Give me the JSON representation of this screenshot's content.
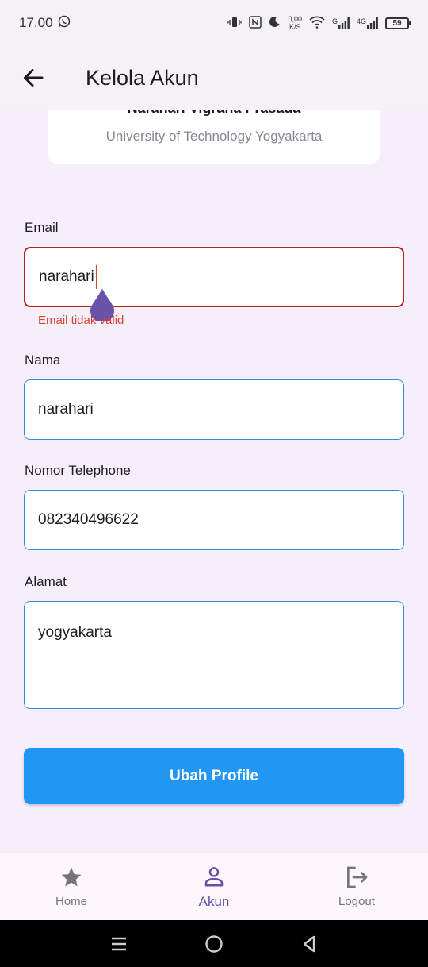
{
  "status_bar": {
    "time": "17.00",
    "net_speed_value": "0,00",
    "net_speed_unit": "K/S",
    "signal1_label": "G",
    "signal2_label": "4G",
    "battery": "59"
  },
  "app_bar": {
    "title": "Kelola Akun"
  },
  "profile": {
    "name": "Narahari Vigrana Prasada",
    "university": "University of Technology Yogyakarta"
  },
  "form": {
    "email": {
      "label": "Email",
      "value": "narahari",
      "error": "Email tidak valid"
    },
    "name": {
      "label": "Nama",
      "value": "narahari"
    },
    "phone": {
      "label": "Nomor Telephone",
      "value": "082340496622"
    },
    "address": {
      "label": "Alamat",
      "value": "yogyakarta"
    },
    "submit_label": "Ubah Profile"
  },
  "bottom_nav": {
    "items": [
      {
        "label": "Home",
        "icon": "star-icon"
      },
      {
        "label": "Akun",
        "icon": "person-icon",
        "active": true
      },
      {
        "label": "Logout",
        "icon": "logout-icon"
      }
    ]
  },
  "colors": {
    "primary": "#2196f3",
    "error": "#b3261e",
    "active_nav": "#6750a4",
    "background": "#f6effb"
  }
}
